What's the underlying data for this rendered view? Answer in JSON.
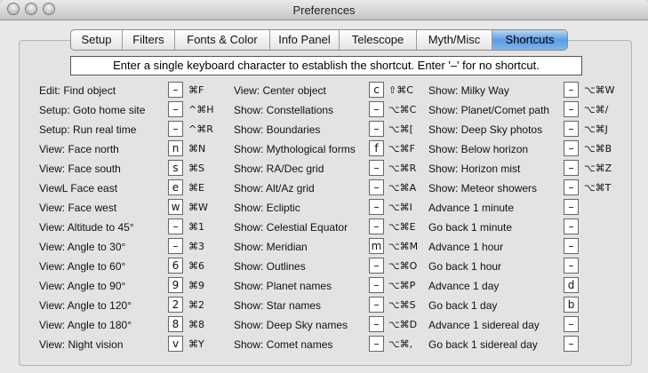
{
  "window": {
    "title": "Preferences"
  },
  "tabs": [
    {
      "label": "Setup"
    },
    {
      "label": "Filters"
    },
    {
      "label": "Fonts & Color"
    },
    {
      "label": "Info Panel"
    },
    {
      "label": "Telescope"
    },
    {
      "label": "Myth/Misc"
    },
    {
      "label": "Shortcuts",
      "active": true
    }
  ],
  "banner": "Enter a single keyboard character to establish the shortcut. Enter '–' for no shortcut.",
  "columns": [
    [
      {
        "label": "Edit: Find object",
        "key": "–",
        "shortcut": "⌘F"
      },
      {
        "label": "Setup: Goto home site",
        "key": "–",
        "shortcut": "^⌘H"
      },
      {
        "label": "Setup: Run real time",
        "key": "–",
        "shortcut": "^⌘R"
      },
      {
        "label": "View: Face north",
        "key": "n",
        "shortcut": "⌘N"
      },
      {
        "label": "View: Face south",
        "key": "s",
        "shortcut": "⌘S"
      },
      {
        "label": "ViewL Face east",
        "key": "e",
        "shortcut": "⌘E"
      },
      {
        "label": "View: Face west",
        "key": "w",
        "shortcut": "⌘W"
      },
      {
        "label": "View: Altitude to 45°",
        "key": "–",
        "shortcut": "⌘1"
      },
      {
        "label": "View: Angle to 30°",
        "key": "–",
        "shortcut": "⌘3"
      },
      {
        "label": "View: Angle to 60°",
        "key": "6",
        "shortcut": "⌘6"
      },
      {
        "label": "View: Angle to 90°",
        "key": "9",
        "shortcut": "⌘9"
      },
      {
        "label": "View: Angle to 120°",
        "key": "2",
        "shortcut": "⌘2"
      },
      {
        "label": "View: Angle to 180°",
        "key": "8",
        "shortcut": "⌘8"
      },
      {
        "label": "View: Night vision",
        "key": "v",
        "shortcut": "⌘Y"
      }
    ],
    [
      {
        "label": "View: Center object",
        "key": "c",
        "shortcut": "⇧⌘C"
      },
      {
        "label": "Show: Constellations",
        "key": "–",
        "shortcut": "⌥⌘C"
      },
      {
        "label": "Show: Boundaries",
        "key": "–",
        "shortcut": "⌥⌘["
      },
      {
        "label": "Show: Mythological forms",
        "key": "f",
        "shortcut": "⌥⌘F"
      },
      {
        "label": "Show: RA/Dec grid",
        "key": "–",
        "shortcut": "⌥⌘R"
      },
      {
        "label": "Show: Alt/Az grid",
        "key": "–",
        "shortcut": "⌥⌘A"
      },
      {
        "label": "Show: Ecliptic",
        "key": "–",
        "shortcut": "⌥⌘I"
      },
      {
        "label": "Show: Celestial Equator",
        "key": "–",
        "shortcut": "⌥⌘E"
      },
      {
        "label": "Show: Meridian",
        "key": "m",
        "shortcut": "⌥⌘M"
      },
      {
        "label": "Show: Outlines",
        "key": "–",
        "shortcut": "⌥⌘O"
      },
      {
        "label": "Show: Planet names",
        "key": "–",
        "shortcut": "⌥⌘P"
      },
      {
        "label": "Show: Star names",
        "key": "–",
        "shortcut": "⌥⌘S"
      },
      {
        "label": "Show: Deep Sky names",
        "key": "–",
        "shortcut": "⌥⌘D"
      },
      {
        "label": "Show: Comet names",
        "key": "–",
        "shortcut": "⌥⌘,"
      }
    ],
    [
      {
        "label": "Show: Milky Way",
        "key": "–",
        "shortcut": "⌥⌘W"
      },
      {
        "label": "Show: Planet/Comet path",
        "key": "–",
        "shortcut": "⌥⌘/"
      },
      {
        "label": "Show: Deep Sky photos",
        "key": "–",
        "shortcut": "⌥⌘J"
      },
      {
        "label": "Show: Below horizon",
        "key": "–",
        "shortcut": "⌥⌘B"
      },
      {
        "label": "Show: Horizon mist",
        "key": "–",
        "shortcut": "⌥⌘Z"
      },
      {
        "label": "Show: Meteor showers",
        "key": "–",
        "shortcut": "⌥⌘T"
      },
      {
        "label": "Advance 1 minute",
        "key": "–",
        "shortcut": ""
      },
      {
        "label": "Go back 1 minute",
        "key": "–",
        "shortcut": ""
      },
      {
        "label": "Advance 1 hour",
        "key": "–",
        "shortcut": ""
      },
      {
        "label": "Go back 1 hour",
        "key": "–",
        "shortcut": ""
      },
      {
        "label": "Advance 1 day",
        "key": "d",
        "shortcut": ""
      },
      {
        "label": "Go back 1 day",
        "key": "b",
        "shortcut": ""
      },
      {
        "label": "Advance 1 sidereal day",
        "key": "–",
        "shortcut": ""
      },
      {
        "label": "Go back 1 sidereal day",
        "key": "–",
        "shortcut": ""
      }
    ]
  ]
}
